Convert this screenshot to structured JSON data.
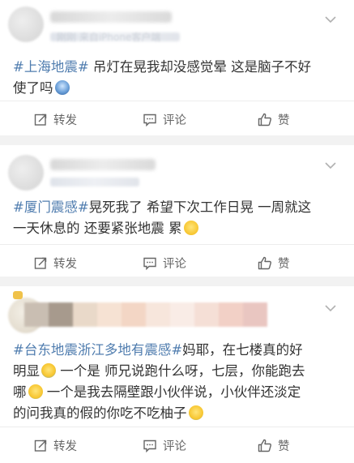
{
  "posts": [
    {
      "meta_text": "刚刚 来自iPhone客户端",
      "content": {
        "tags": [
          "#上海地震#"
        ],
        "line1_rest": " 吊灯在晃我却没感觉晕 这是脑子不好",
        "line2": "使了吗"
      },
      "emojis": [
        "fright-face"
      ],
      "actions": {
        "repost": "转发",
        "comment": "评论",
        "like": "赞"
      }
    },
    {
      "content": {
        "tag": "#厦门震感#",
        "line1_rest": "晃死我了 希望下次工作日晃 一周就这",
        "line2": "一天休息的 还要紧张地震 累"
      },
      "emojis": [
        "dizzy-face"
      ],
      "actions": {
        "repost": "转发",
        "comment": "评论",
        "like": "赞"
      }
    },
    {
      "content": {
        "tag": "#台东地震浙江多地有震感#",
        "line1_rest": "妈耶，在七楼真的好",
        "line2": "明显",
        "line2_rest": " 一个是 师兄说跑什么呀，七层，你能跑去",
        "line3": "哪",
        "line3_rest": " 一个是我去隔壁跟小伙伴说，小伙伴还淡定",
        "line4": "的问我真的假的你吃不吃柚子"
      },
      "emojis": [
        "crying-face",
        "laughing-face"
      ],
      "actions": {
        "repost": "转发",
        "comment": "评论",
        "like": "赞"
      }
    }
  ],
  "colors": {
    "topic": "#507daf",
    "text": "#333333",
    "action": "#666666",
    "separator": "#f2f2f2"
  }
}
